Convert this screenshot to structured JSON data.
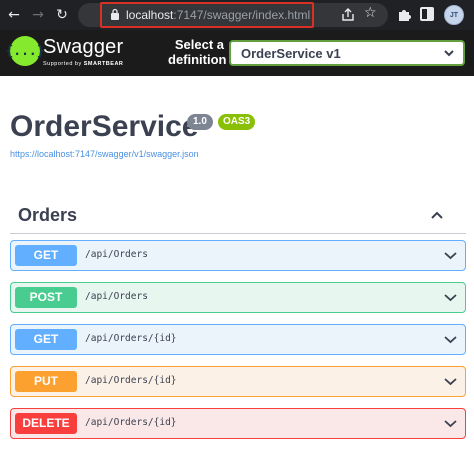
{
  "browser": {
    "url_host": "localhost",
    "url_rest": ":7147/swagger/index.html",
    "profile_initials": "JT"
  },
  "topbar": {
    "logo_glyph": "{...}",
    "brand_name": "Swagger",
    "brand_sub_prefix": "Supported by ",
    "brand_sub_company": "SMARTBEAR",
    "select_label": "Select a definition",
    "selected_definition": "OrderService v1"
  },
  "info": {
    "title": "OrderService",
    "version": "1.0",
    "oas": "OAS3",
    "spec_url": "https://localhost:7147/swagger/v1/swagger.json"
  },
  "section": {
    "title": "Orders"
  },
  "operations": [
    {
      "method": "GET",
      "path": "/api/Orders"
    },
    {
      "method": "POST",
      "path": "/api/Orders"
    },
    {
      "method": "GET",
      "path": "/api/Orders/{id}"
    },
    {
      "method": "PUT",
      "path": "/api/Orders/{id}"
    },
    {
      "method": "DELETE",
      "path": "/api/Orders/{id}"
    }
  ],
  "colors": {
    "get": "#61affe",
    "post": "#49cc90",
    "put": "#fca130",
    "delete": "#f93e3e",
    "topbar": "#1b1b1b",
    "logo": "#85ea2d"
  },
  "icons": [
    "back-arrow-icon",
    "forward-arrow-icon",
    "reload-icon",
    "lock-icon",
    "share-icon",
    "star-icon",
    "extensions-icon",
    "side-panel-icon",
    "chevron-down-icon",
    "chevron-up-icon"
  ]
}
